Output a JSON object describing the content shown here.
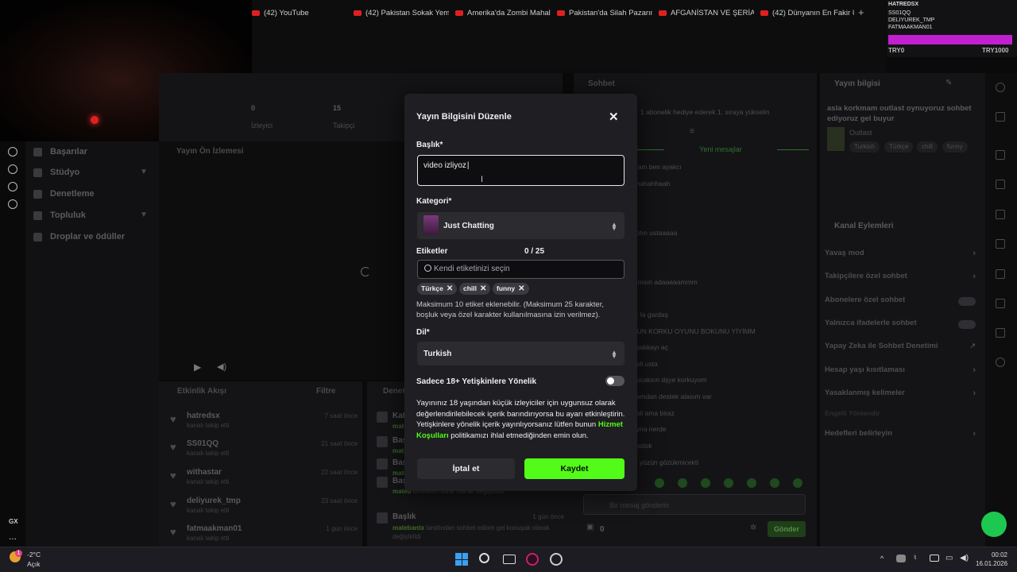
{
  "browser": {
    "tabs": [
      {
        "label": "(42) YouTube"
      },
      {
        "label": "(42) Pakistan Sokak Yeme"
      },
      {
        "label": "Amerika'da Zombi Mahalle"
      },
      {
        "label": "Pakistan'da Silah Pazarına"
      },
      {
        "label": "AFGANİSTAN VE ŞERİAT Y"
      },
      {
        "label": "(42) Dünyanın En Fakir Ülk"
      }
    ],
    "new_tab": "+"
  },
  "viewer_widget": {
    "names": [
      "HATREDSX",
      "SS01QQ",
      "DELIYUREK_TMP",
      "FATMAAKMAN01"
    ],
    "left_label": "TRY0",
    "right_label": "TRY1000",
    "accent": "#c020d0"
  },
  "rail": {
    "gx": "GX",
    "more": "..."
  },
  "nav": {
    "items": [
      {
        "label": "Başarılar"
      },
      {
        "label": "Stüdyo"
      },
      {
        "label": "Denetleme"
      },
      {
        "label": "Topluluk"
      },
      {
        "label": "Droplar ve ödüller"
      }
    ]
  },
  "dashboard": {
    "stat1_value": "0",
    "stat1_label": "İzleyici",
    "stat2_value": "15",
    "stat2_label": "Takipçi",
    "preview_title": "Yayın Ön İzlemesi",
    "activity_title": "Etkinlik Akışı",
    "activity_filter": "Filtre",
    "events2_title": "Denet",
    "activity": [
      {
        "user": "hatredsx",
        "action": "kanalı takip etti",
        "time": "7 saat önce"
      },
      {
        "user": "SS01QQ",
        "action": "kanalı takip etti",
        "time": "21 saat önce"
      },
      {
        "user": "withastar",
        "action": "kanalı takip etti",
        "time": "22 saat önce"
      },
      {
        "user": "deliyurek_tmp",
        "action": "kanalı takip etti",
        "time": "23 saat önce"
      },
      {
        "user": "fatmaakman01",
        "action": "kanalı takip etti",
        "time": "1 gün önce"
      }
    ],
    "events2": [
      {
        "head": "Kat",
        "desc_user": "mate",
        "desc": ""
      },
      {
        "head": "Baş",
        "desc_user": "mateb",
        "desc": ""
      },
      {
        "head": "Baş",
        "desc_user": "mateb",
        "desc": ""
      },
      {
        "head": "Baş",
        "desc_user": "mateb",
        "desc": "sohbetim sarar olarak değiştirildi"
      },
      {
        "head": "Başlık",
        "desc_user": "matebantx",
        "desc": "tarafından sohbet ediom gel konuşak olarak değiştirildi",
        "time": "1 gün önce"
      }
    ]
  },
  "chat": {
    "title": "Sohbet",
    "banner": "1 abonelik hediye ederek 1. sıraya yükselin",
    "new_messages": "Yeni mesajlar",
    "lines": [
      "elam ben ayakcı",
      "ahahahhaah",
      "",
      "y",
      "aptın ustaaaaa",
      "",
      "",
      "lamsın adaaaaammm",
      "",
      "or la gardaş",
      "YUN KORKU OYUNU BOKUNU YİYİMM",
      "asakkayı aç",
      "neli usta",
      "mıcaksın dşye korkuyom",
      "damdan destek alasım var",
      "hali ama biraz",
      "eyna nerde",
      "kostok",
      "ni yüzün gözükmicekti"
    ],
    "input_placeholder": "Bir mesaj gönderin",
    "points": "0",
    "send_label": "Gönder"
  },
  "stream_info": {
    "title": "Yayın bilgisi",
    "stream_title": "asla korkmam outlast oynuyoruz sohbet ediyoruz gel buyur",
    "category": "Outlast",
    "tags": [
      "Turkish",
      "Türkçe",
      "chill",
      "funny"
    ]
  },
  "channel_actions": {
    "title": "Kanal Eylemleri",
    "items": [
      {
        "label": "Yavaş mod",
        "kind": "chevron"
      },
      {
        "label": "Takipçilere özel sohbet",
        "kind": "chevron"
      },
      {
        "label": "Abonelere özel sohbet",
        "kind": "toggle"
      },
      {
        "label": "Yalnızca ifadelerle sohbet",
        "kind": "toggle"
      },
      {
        "label": "Yapay Zeka ile Sohbet Denetimi",
        "kind": "link"
      },
      {
        "label": "Hesap yaşı kısıtlaması",
        "kind": "chevron"
      },
      {
        "label": "Yasaklanmış kelimeler",
        "kind": "chevron"
      },
      {
        "label": "Engelli Yönlendir",
        "kind": "none"
      },
      {
        "label": "Hedefleri belirleyin",
        "kind": "chevron"
      }
    ]
  },
  "modal": {
    "title": "Yayın Bilgisini Düzenle",
    "close": "✕",
    "title_label": "Başlık*",
    "title_value": "video izliyoz",
    "category_label": "Kategori*",
    "category_value": "Just Chatting",
    "tags_label": "Etiketler",
    "tags_count": "0 / 25",
    "tags_placeholder": "Kendi etiketinizi seçin",
    "tags": [
      "Türkçe",
      "chill",
      "funny"
    ],
    "tags_help": "Maksimum 10 etiket eklenebilir. (Maksimum 25 karakter, boşluk veya özel karakter kullanılmasına izin verilmez).",
    "language_label": "Dil*",
    "language_value": "Turkish",
    "adult_label": "Sadece 18+ Yetişkinlere Yönelik",
    "adult_on": false,
    "adult_text_1": "Yayınınız 18 yaşından küçük izleyiciler için uygunsuz olarak değerlendirilebilecek içerik barındırıyorsa bu ayarı etkinleştirin. Yetişkinlere yönelik içerik yayınlıyorsanız lütfen bunun ",
    "adult_link": "Hizmet Koşulları",
    "adult_text_2": " politikamızı ihlal etmediğinden emin olun.",
    "cancel_label": "İptal et",
    "save_label": "Kaydet",
    "accent": "#53fc18"
  },
  "taskbar": {
    "temp": "-2°C",
    "weather": "Açık",
    "time": "00:02",
    "date": "16.01.2026",
    "badge": "1"
  }
}
